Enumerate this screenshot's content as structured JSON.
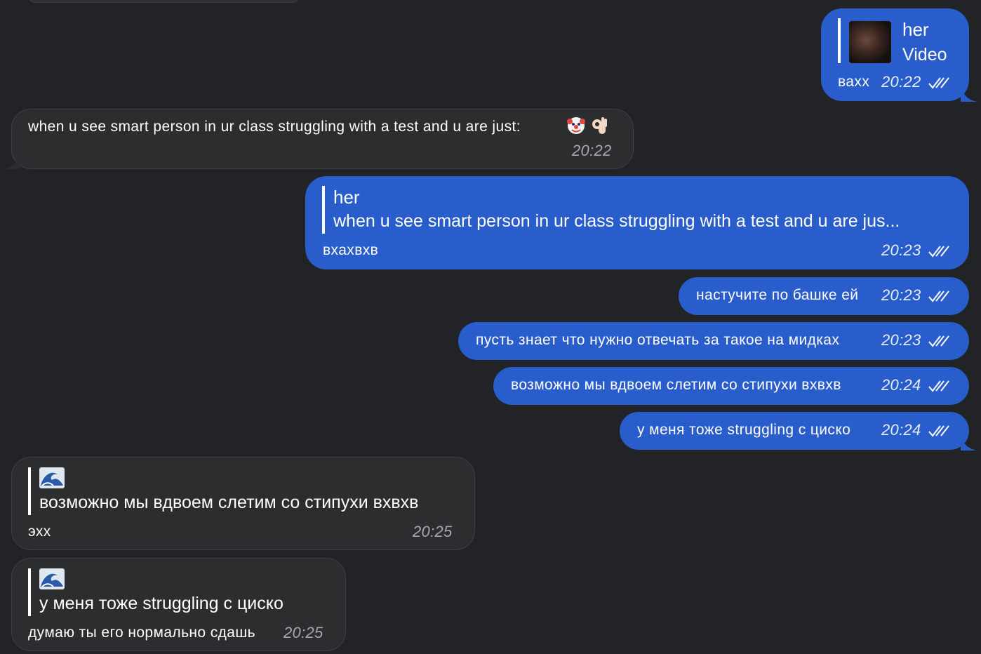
{
  "messages": {
    "m1": {
      "reply_name": "her",
      "reply_text": "Video",
      "text": "вахх",
      "time": "20:22"
    },
    "m2": {
      "text": "when u see smart person in ur class struggling with a test and u are just:",
      "time": "20:22",
      "emojis": [
        "clown-face",
        "ok-hand"
      ]
    },
    "m3": {
      "reply_name": "her",
      "reply_text": "when u see smart person in ur class struggling with a test and u are jus...",
      "text": "вхахвхв",
      "time": "20:23"
    },
    "m4": {
      "text": "настучите по башке ей",
      "time": "20:23"
    },
    "m5": {
      "text": "пусть знает что нужно отвечать за такое на мидках",
      "time": "20:23"
    },
    "m6": {
      "text": "возможно мы вдвоем слетим со стипухи вхвхв",
      "time": "20:24"
    },
    "m7": {
      "text": "у меня тоже struggling с циско",
      "time": "20:24"
    },
    "m8": {
      "reply_emoji": "water-wave",
      "reply_text": "возможно мы вдвоем слетим со стипухи вхвхв",
      "text": "эхх",
      "time": "20:25"
    },
    "m9": {
      "reply_emoji": "water-wave",
      "reply_text": "у меня тоже struggling с циско",
      "text": "думаю ты его нормально сдашь",
      "time": "20:25"
    }
  },
  "colors": {
    "background": "#212326",
    "outgoing_bubble": "#2a5dcc",
    "incoming_bubble": "#2c2d2f",
    "read_ticks": "#ffffff"
  }
}
